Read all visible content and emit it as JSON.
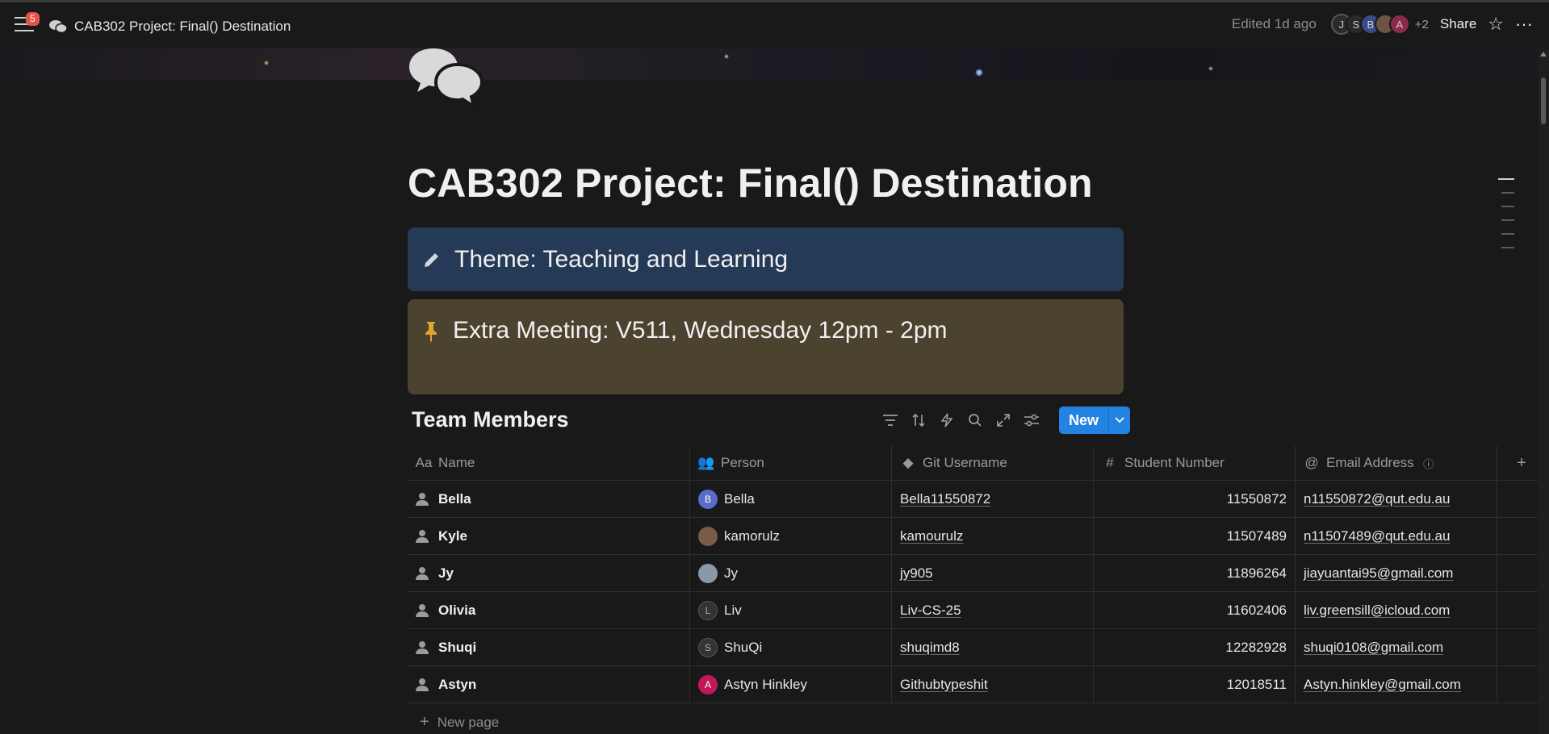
{
  "topbar": {
    "notification_count": "5",
    "breadcrumb_title": "CAB302 Project: Final() Destination",
    "edited": "Edited 1d ago",
    "avatars": [
      "J",
      "S",
      "B",
      "",
      "A"
    ],
    "extra_count": "+2",
    "share_label": "Share",
    "more_label": "···"
  },
  "page": {
    "title": "CAB302 Project: Final() Destination",
    "callouts": [
      {
        "icon": "pencil-icon",
        "text": "Theme: Teaching and Learning",
        "color": "#253a56"
      },
      {
        "icon": "pin-icon",
        "text": "Extra Meeting: V511, Wednesday 12pm - 2pm",
        "color": "#4b4330"
      }
    ]
  },
  "database": {
    "title": "Team Members",
    "new_label": "New",
    "columns": [
      "Name",
      "Person",
      "Git Username",
      "Student Number",
      "Email Address"
    ],
    "rows": [
      {
        "name": "Bella",
        "person": "Bella",
        "person_initial": "B",
        "person_color": "#5b6bc9",
        "git": "Bella11550872",
        "student": "11550872",
        "email": "n11550872@qut.edu.au"
      },
      {
        "name": "Kyle",
        "person": "kamorulz",
        "person_initial": "",
        "person_color": "#7a5a48",
        "git": "kamourulz",
        "student": "11507489",
        "email": "n11507489@qut.edu.au"
      },
      {
        "name": "Jy",
        "person": "Jy",
        "person_initial": "",
        "person_color": "#8899aa",
        "git": "jy905",
        "student": "11896264",
        "email": "jiayuantai95@gmail.com"
      },
      {
        "name": "Olivia",
        "person": "Liv",
        "person_initial": "L",
        "person_color": "#333333",
        "git": "Liv-CS-25",
        "student": "11602406",
        "email": "liv.greensill@icloud.com"
      },
      {
        "name": "Shuqi",
        "person": "ShuQi",
        "person_initial": "S",
        "person_color": "#333333",
        "git": "shuqimd8",
        "student": "12282928",
        "email": "shuqi0108@gmail.com"
      },
      {
        "name": "Astyn",
        "person": "Astyn Hinkley",
        "person_initial": "A",
        "person_color": "#c2185b",
        "git": "Githubtypeshit",
        "student": "12018511",
        "email": "Astyn.hinkley@gmail.com"
      }
    ],
    "new_page_label": "New page"
  }
}
